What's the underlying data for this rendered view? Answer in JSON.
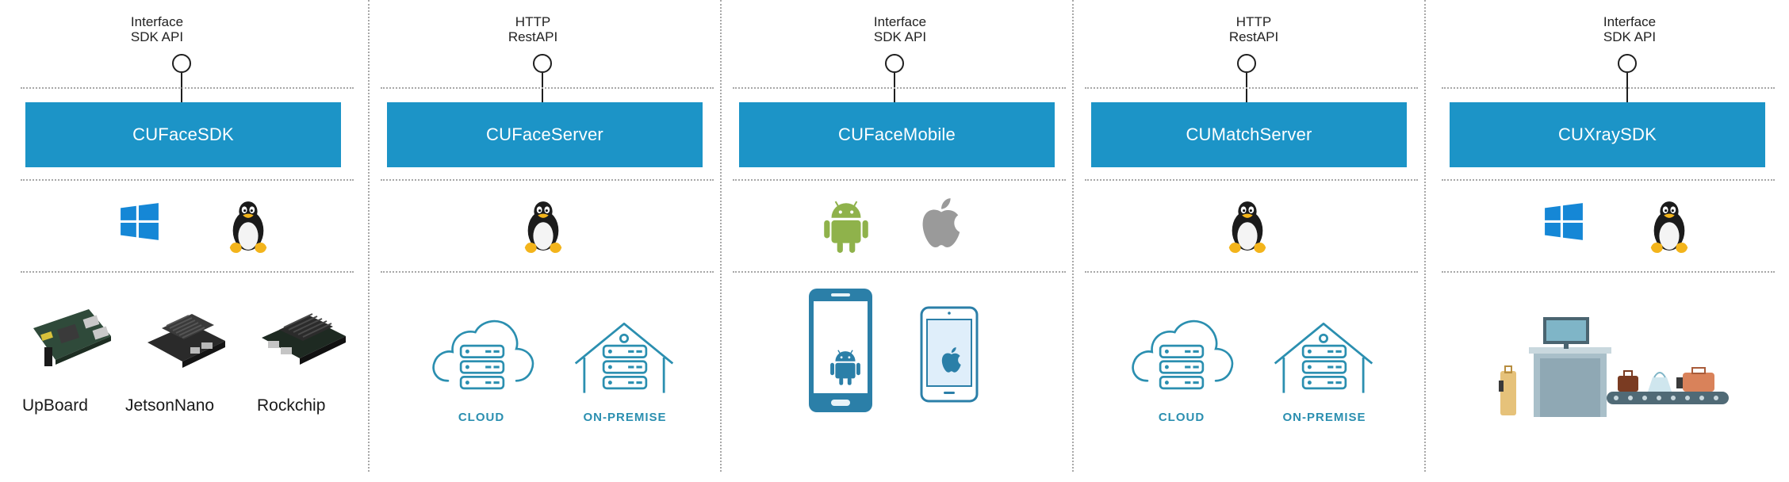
{
  "columns": [
    {
      "api": [
        "Interface",
        "SDK API"
      ],
      "product": "CUFaceSDK",
      "platforms": [
        "windows-icon",
        "linux-tux-icon"
      ],
      "hardware": [
        {
          "label": "UpBoard",
          "icon": "upboard-board-icon"
        },
        {
          "label": "JetsonNano",
          "icon": "jetson-nano-board-icon"
        },
        {
          "label": "Rockchip",
          "icon": "rockchip-board-icon"
        }
      ]
    },
    {
      "api": [
        "HTTP",
        "RestAPI"
      ],
      "product": "CUFaceServer",
      "platforms": [
        "linux-tux-icon"
      ],
      "deployment": [
        {
          "label": "CLOUD",
          "icon": "cloud-server-icon"
        },
        {
          "label": "ON-PREMISE",
          "icon": "on-premise-server-icon"
        }
      ]
    },
    {
      "api": [
        "Interface",
        "SDK API"
      ],
      "product": "CUFaceMobile",
      "platforms": [
        "android-icon",
        "apple-icon"
      ],
      "devices": [
        "android-phone-icon",
        "iphone-icon"
      ]
    },
    {
      "api": [
        "HTTP",
        "RestAPI"
      ],
      "product": "CUMatchServer",
      "platforms": [
        "linux-tux-icon"
      ],
      "deployment": [
        {
          "label": "CLOUD",
          "icon": "cloud-server-icon"
        },
        {
          "label": "ON-PREMISE",
          "icon": "on-premise-server-icon"
        }
      ]
    },
    {
      "api": [
        "Interface",
        "SDK API"
      ],
      "product": "CUXraySDK",
      "platforms": [
        "windows-icon",
        "linux-tux-icon"
      ],
      "illustration": "xray-baggage-scanner-icon"
    }
  ],
  "colors": {
    "product_box": "#1c94c7",
    "deploy_icon": "#2b8fb0",
    "windows": "#1587d6",
    "android": "#8fb24b",
    "apple": "#9a9a9a"
  }
}
